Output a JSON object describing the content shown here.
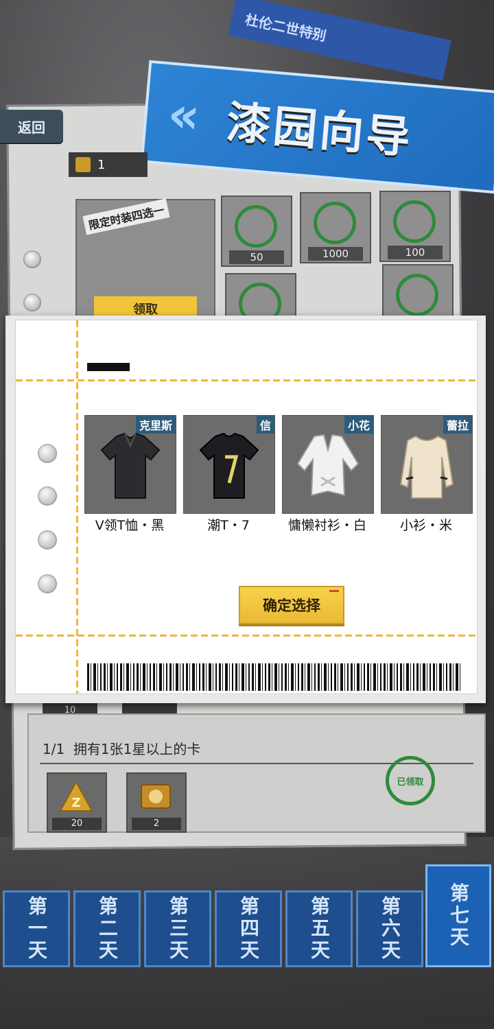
{
  "header": {
    "back_label": "返回",
    "title": "漆园向导",
    "title_tag": "杜伦二世特别"
  },
  "background": {
    "ticket_count": "1",
    "limited_label": "限定时装四选一",
    "claim_label": "领取",
    "reward_values": [
      "50",
      "1000",
      "100"
    ],
    "mini_values": [
      "10"
    ],
    "task": {
      "progress": "1/1",
      "text": "拥有1张1星以上的卡",
      "items": [
        "20",
        "2"
      ],
      "claimed_label": "已领取"
    }
  },
  "dialog": {
    "items": [
      {
        "character": "克里斯",
        "name": "V领T恤・黑"
      },
      {
        "character": "信",
        "name": "潮T・7"
      },
      {
        "character": "小花",
        "name": "慵懒衬衫・白"
      },
      {
        "character": "蕾拉",
        "name": "小衫・米"
      }
    ],
    "confirm_label": "确定选择"
  },
  "days": {
    "tabs": [
      "第一天",
      "第二天",
      "第三天",
      "第四天",
      "第五天",
      "第六天",
      "第七天"
    ],
    "active_index": 6
  },
  "colors": {
    "accent_yellow": "#f0c53a",
    "tab_blue": "#1e4e8e",
    "stamp_green": "#2f8a3a"
  }
}
